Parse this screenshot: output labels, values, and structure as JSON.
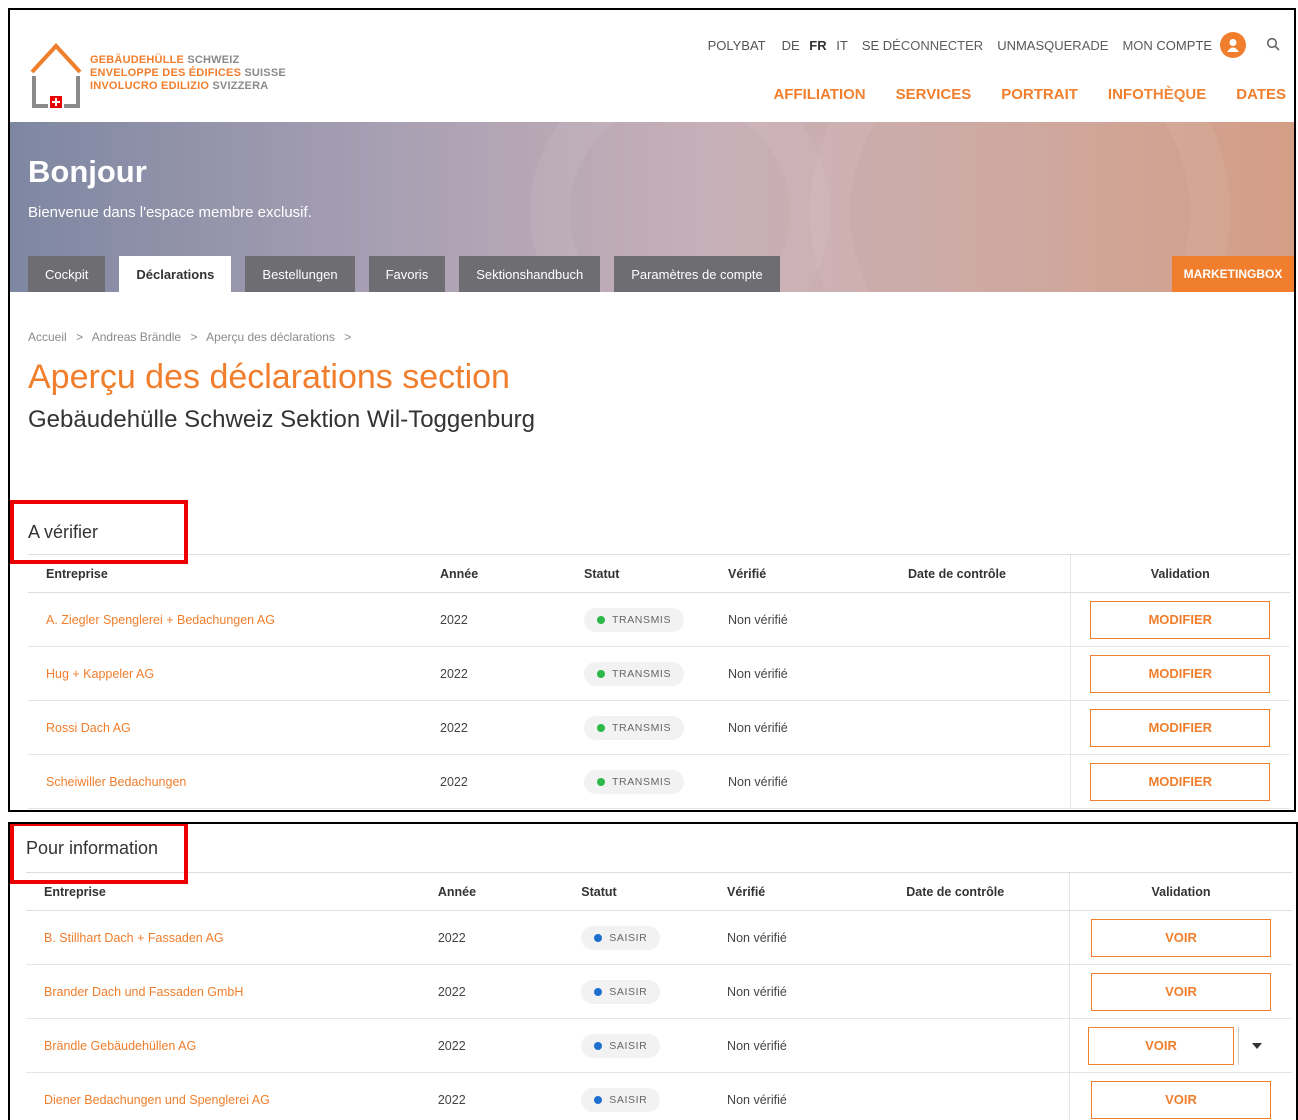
{
  "logo": {
    "line1_a": "GEBÄUDEHÜLLE",
    "line1_b": " SCHWEIZ",
    "line2_a": "ENVELOPPE DES ÉDIFICES",
    "line2_b": " SUISSE",
    "line3_a": "INVOLUCRO EDILIZIO",
    "line3_b": " SVIZZERA"
  },
  "topnav": {
    "polybat": "POLYBAT",
    "lang_de": "DE",
    "lang_fr": "FR",
    "lang_it": "IT",
    "logout": "SE DÉCONNECTER",
    "unmasquerade": "UNMASQUERADE",
    "account": "MON COMPTE"
  },
  "mainnav": [
    "AFFILIATION",
    "SERVICES",
    "PORTRAIT",
    "INFOTHÈQUE",
    "DATES"
  ],
  "hero": {
    "title": "Bonjour",
    "subtitle": "Bienvenue dans l'espace membre exclusif.",
    "tabs": [
      "Cockpit",
      "Déclarations",
      "Bestellungen",
      "Favoris",
      "Sektionshandbuch",
      "Paramètres de compte"
    ],
    "marketing": "MARKETINGBOX"
  },
  "breadcrumb": [
    "Accueil",
    ">",
    "Andreas Brändle",
    ">",
    "Aperçu des déclarations",
    ">"
  ],
  "page_title": "Aperçu des déclarations section",
  "org_title": "Gebäudehülle Schweiz Sektion Wil-Toggenburg",
  "columns": [
    "Entreprise",
    "Année",
    "Statut",
    "Vérifié",
    "Date de contrôle",
    "Validation"
  ],
  "section1": {
    "title": "A vérifier",
    "rows": [
      {
        "company": "A. Ziegler Spenglerei + Bedachungen AG",
        "year": "2022",
        "status": "TRANSMIS",
        "verified": "Non vérifié",
        "date": "",
        "action": "MODIFIER"
      },
      {
        "company": "Hug + Kappeler AG",
        "year": "2022",
        "status": "TRANSMIS",
        "verified": "Non vérifié",
        "date": "",
        "action": "MODIFIER"
      },
      {
        "company": "Rossi Dach AG",
        "year": "2022",
        "status": "TRANSMIS",
        "verified": "Non vérifié",
        "date": "",
        "action": "MODIFIER"
      },
      {
        "company": "Scheiwiller Bedachungen",
        "year": "2022",
        "status": "TRANSMIS",
        "verified": "Non vérifié",
        "date": "",
        "action": "MODIFIER"
      }
    ]
  },
  "section2": {
    "title": "Pour information",
    "rows": [
      {
        "company": "B. Stillhart Dach + Fassaden AG",
        "year": "2022",
        "status": "SAISIR",
        "verified": "Non vérifié",
        "date": "",
        "action": "VOIR"
      },
      {
        "company": "Brander Dach und Fassaden GmbH",
        "year": "2022",
        "status": "SAISIR",
        "verified": "Non vérifié",
        "date": "",
        "action": "VOIR"
      },
      {
        "company": "Brändle Gebäudehüllen AG",
        "year": "2022",
        "status": "SAISIR",
        "verified": "Non vérifié",
        "date": "",
        "action": "VOIR"
      },
      {
        "company": "Diener Bedachungen und Spenglerei AG",
        "year": "2022",
        "status": "SAISIR",
        "verified": "Non vérifié",
        "date": "",
        "action": "VOIR"
      }
    ]
  },
  "colors": {
    "accent": "#f07e2c",
    "status_transmis": "#2db84a",
    "status_saisir": "#1f6fd1",
    "highlight": "#e00000"
  }
}
